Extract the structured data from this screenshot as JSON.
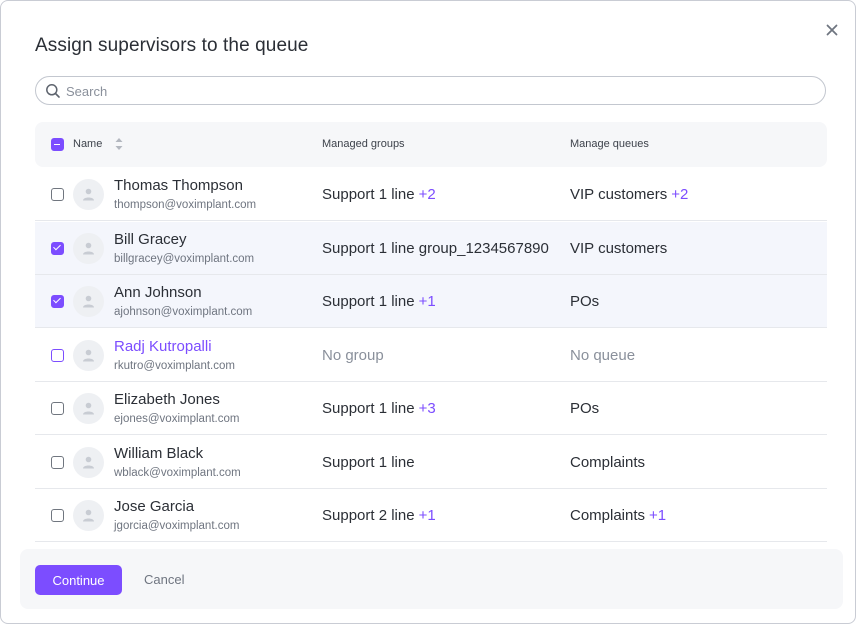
{
  "dialog": {
    "title": "Assign supervisors to the queue",
    "close_icon": "close-icon"
  },
  "search": {
    "placeholder": "Search",
    "value": ""
  },
  "table": {
    "columns": {
      "name": "Name",
      "groups": "Managed groups",
      "queues": "Manage queues"
    },
    "rows": [
      {
        "name": "Thomas Thompson",
        "email": "thompson@voximplant.com",
        "checked": false,
        "group": "Support 1 line",
        "group_extra": "+2",
        "queue": "VIP customers",
        "queue_extra": "+2"
      },
      {
        "name": "Bill Gracey",
        "email": "billgracey@voximplant.com",
        "checked": true,
        "group": "Support 1 line group_1234567890",
        "group_extra": "",
        "queue": "VIP customers",
        "queue_extra": ""
      },
      {
        "name": "Ann Johnson",
        "email": "ajohnson@voximplant.com",
        "checked": true,
        "group": "Support 1 line",
        "group_extra": "+1",
        "queue": "POs",
        "queue_extra": ""
      },
      {
        "name": "Radj Kutropalli",
        "email": "rkutro@voximplant.com",
        "checked": false,
        "group": "No group",
        "group_extra": "",
        "queue": "No queue",
        "queue_extra": ""
      },
      {
        "name": "Elizabeth Jones",
        "email": "ejones@voximplant.com",
        "checked": false,
        "group": "Support 1 line",
        "group_extra": "+3",
        "queue": "POs",
        "queue_extra": ""
      },
      {
        "name": "William Black",
        "email": "wblack@voximplant.com",
        "checked": false,
        "group": "Support 1 line",
        "group_extra": "",
        "queue": "Complaints",
        "queue_extra": ""
      },
      {
        "name": "Jose Garcia",
        "email": "jgorcia@voximplant.com",
        "checked": false,
        "group": "Support 2 line",
        "group_extra": "+1",
        "queue": "Complaints",
        "queue_extra": "+1"
      }
    ]
  },
  "footer": {
    "continue_label": "Continue",
    "cancel_label": "Cancel"
  },
  "colors": {
    "accent": "#7c4dff",
    "muted": "#8a909b",
    "selected_row": "#f4f6fc"
  }
}
